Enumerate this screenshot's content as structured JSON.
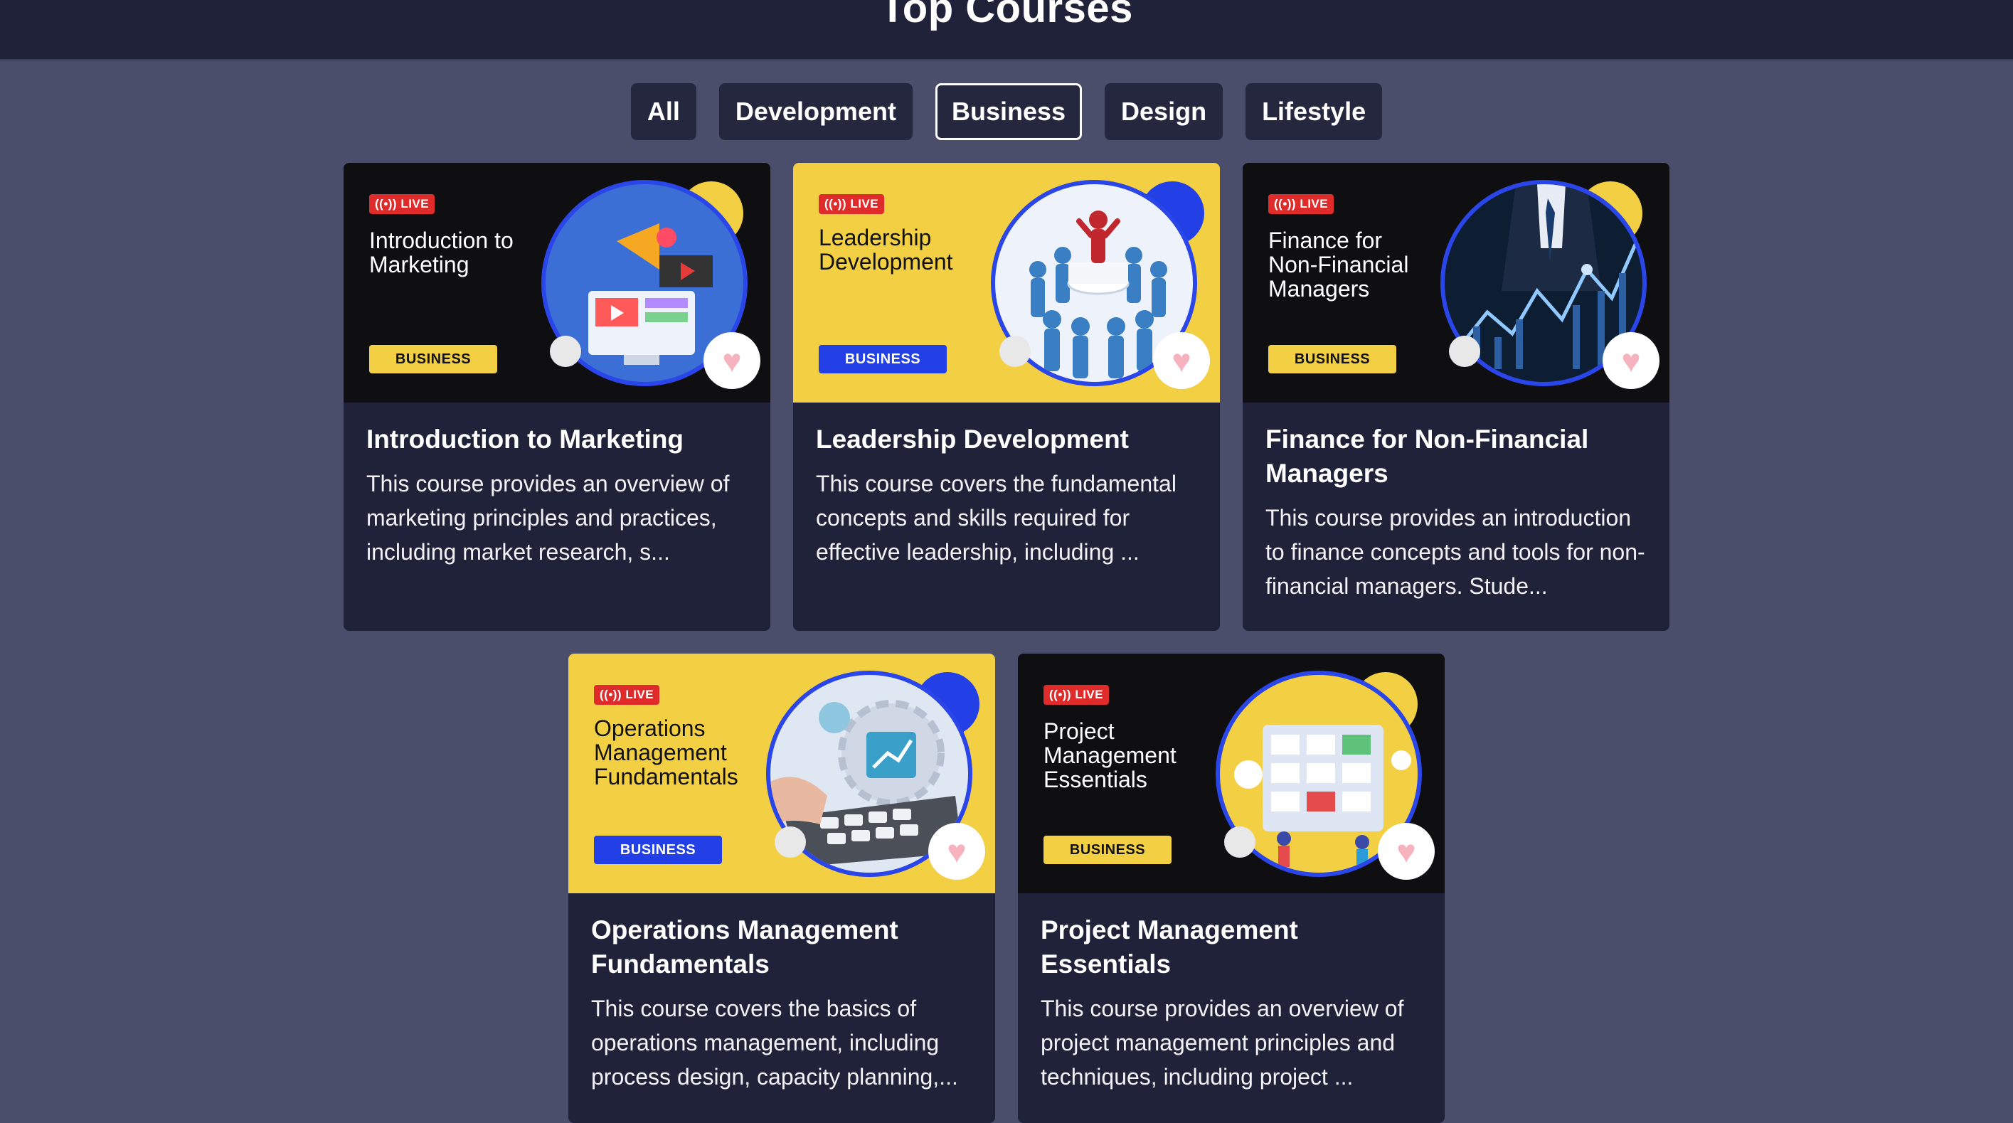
{
  "page": {
    "title": "Top Courses"
  },
  "filters": [
    {
      "label": "All",
      "active": false
    },
    {
      "label": "Development",
      "active": false
    },
    {
      "label": "Business",
      "active": true
    },
    {
      "label": "Design",
      "active": false
    },
    {
      "label": "Lifestyle",
      "active": false
    }
  ],
  "courses": [
    {
      "thumb_theme": "dark",
      "badge": "LIVE",
      "thumb_title": "Introduction to Marketing",
      "category": "BUSINESS",
      "title": "Introduction to Marketing",
      "description": "This course provides an overview of marketing principles and practices, including market research, s..."
    },
    {
      "thumb_theme": "yellow",
      "badge": "LIVE",
      "thumb_title": "Leadership Development",
      "category": "BUSINESS",
      "title": "Leadership Development",
      "description": "This course covers the fundamental concepts and skills required for effective leadership, including ..."
    },
    {
      "thumb_theme": "dark",
      "badge": "LIVE",
      "thumb_title": "Finance for Non-Financial Managers",
      "category": "BUSINESS",
      "title": "Finance for Non-Financial Managers",
      "description": "This course provides an introduction to finance concepts and tools for non-financial managers. Stude..."
    },
    {
      "thumb_theme": "yellow",
      "badge": "LIVE",
      "thumb_title": "Operations Management Fundamentals",
      "category": "BUSINESS",
      "title": "Operations Management Fundamentals",
      "description": "This course covers the basics of operations management, including process design, capacity planning,..."
    },
    {
      "thumb_theme": "dark",
      "badge": "LIVE",
      "thumb_title": "Project Management Essentials",
      "category": "BUSINESS",
      "title": "Project Management Essentials",
      "description": "This course provides an overview of project management principles and techniques, including project ..."
    }
  ],
  "icons": {
    "heart": "heart-icon",
    "live": "broadcast-icon"
  },
  "colors": {
    "background": "#4a4e6a",
    "header": "#20223a",
    "card": "#20223a",
    "accent_yellow": "#f3cf44",
    "accent_blue": "#2240e6",
    "live_red": "#e02b2b"
  }
}
